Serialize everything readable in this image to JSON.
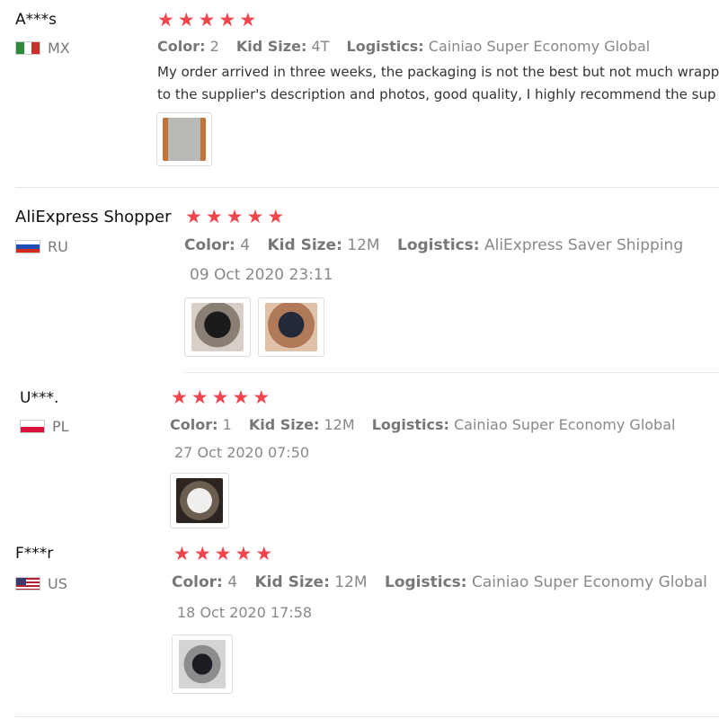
{
  "reviews": [
    {
      "name": "A***s",
      "country": "MX",
      "flag_icon": "mexico-flag-icon",
      "rating": 5,
      "color_label": "Color:",
      "color_value": "2",
      "size_label": "Kid Size:",
      "size_value": "4T",
      "logistics_label": "Logistics:",
      "logistics_value": "Cainiao Super Economy Global",
      "text_line1": "My order arrived in three weeks, the packaging is not the best but not much wrapp",
      "text_line2": "to the supplier's description and photos, good quality, I highly recommend the sup"
    },
    {
      "name": "AliExpress Shopper",
      "country": "RU",
      "flag_icon": "russia-flag-icon",
      "rating": 5,
      "color_label": "Color:",
      "color_value": "4",
      "size_label": "Kid Size:",
      "size_value": "12M",
      "logistics_label": "Logistics:",
      "logistics_value": "AliExpress Saver Shipping",
      "date": "09 Oct 2020 23:11"
    },
    {
      "name": "U***.",
      "country": "PL",
      "flag_icon": "poland-flag-icon",
      "rating": 5,
      "color_label": "Color:",
      "color_value": "1",
      "size_label": "Kid Size:",
      "size_value": "12M",
      "logistics_label": "Logistics:",
      "logistics_value": "Cainiao Super Economy Global",
      "date": "27 Oct 2020 07:50"
    },
    {
      "name": "F***r",
      "country": "US",
      "flag_icon": "usa-flag-icon",
      "rating": 5,
      "color_label": "Color:",
      "color_value": "4",
      "size_label": "Kid Size:",
      "size_value": "12M",
      "logistics_label": "Logistics:",
      "logistics_value": "Cainiao Super Economy Global",
      "date": "18 Oct 2020 17:58"
    }
  ],
  "colors": {
    "star": "#f0454d",
    "divider": "#e6e6e6"
  }
}
